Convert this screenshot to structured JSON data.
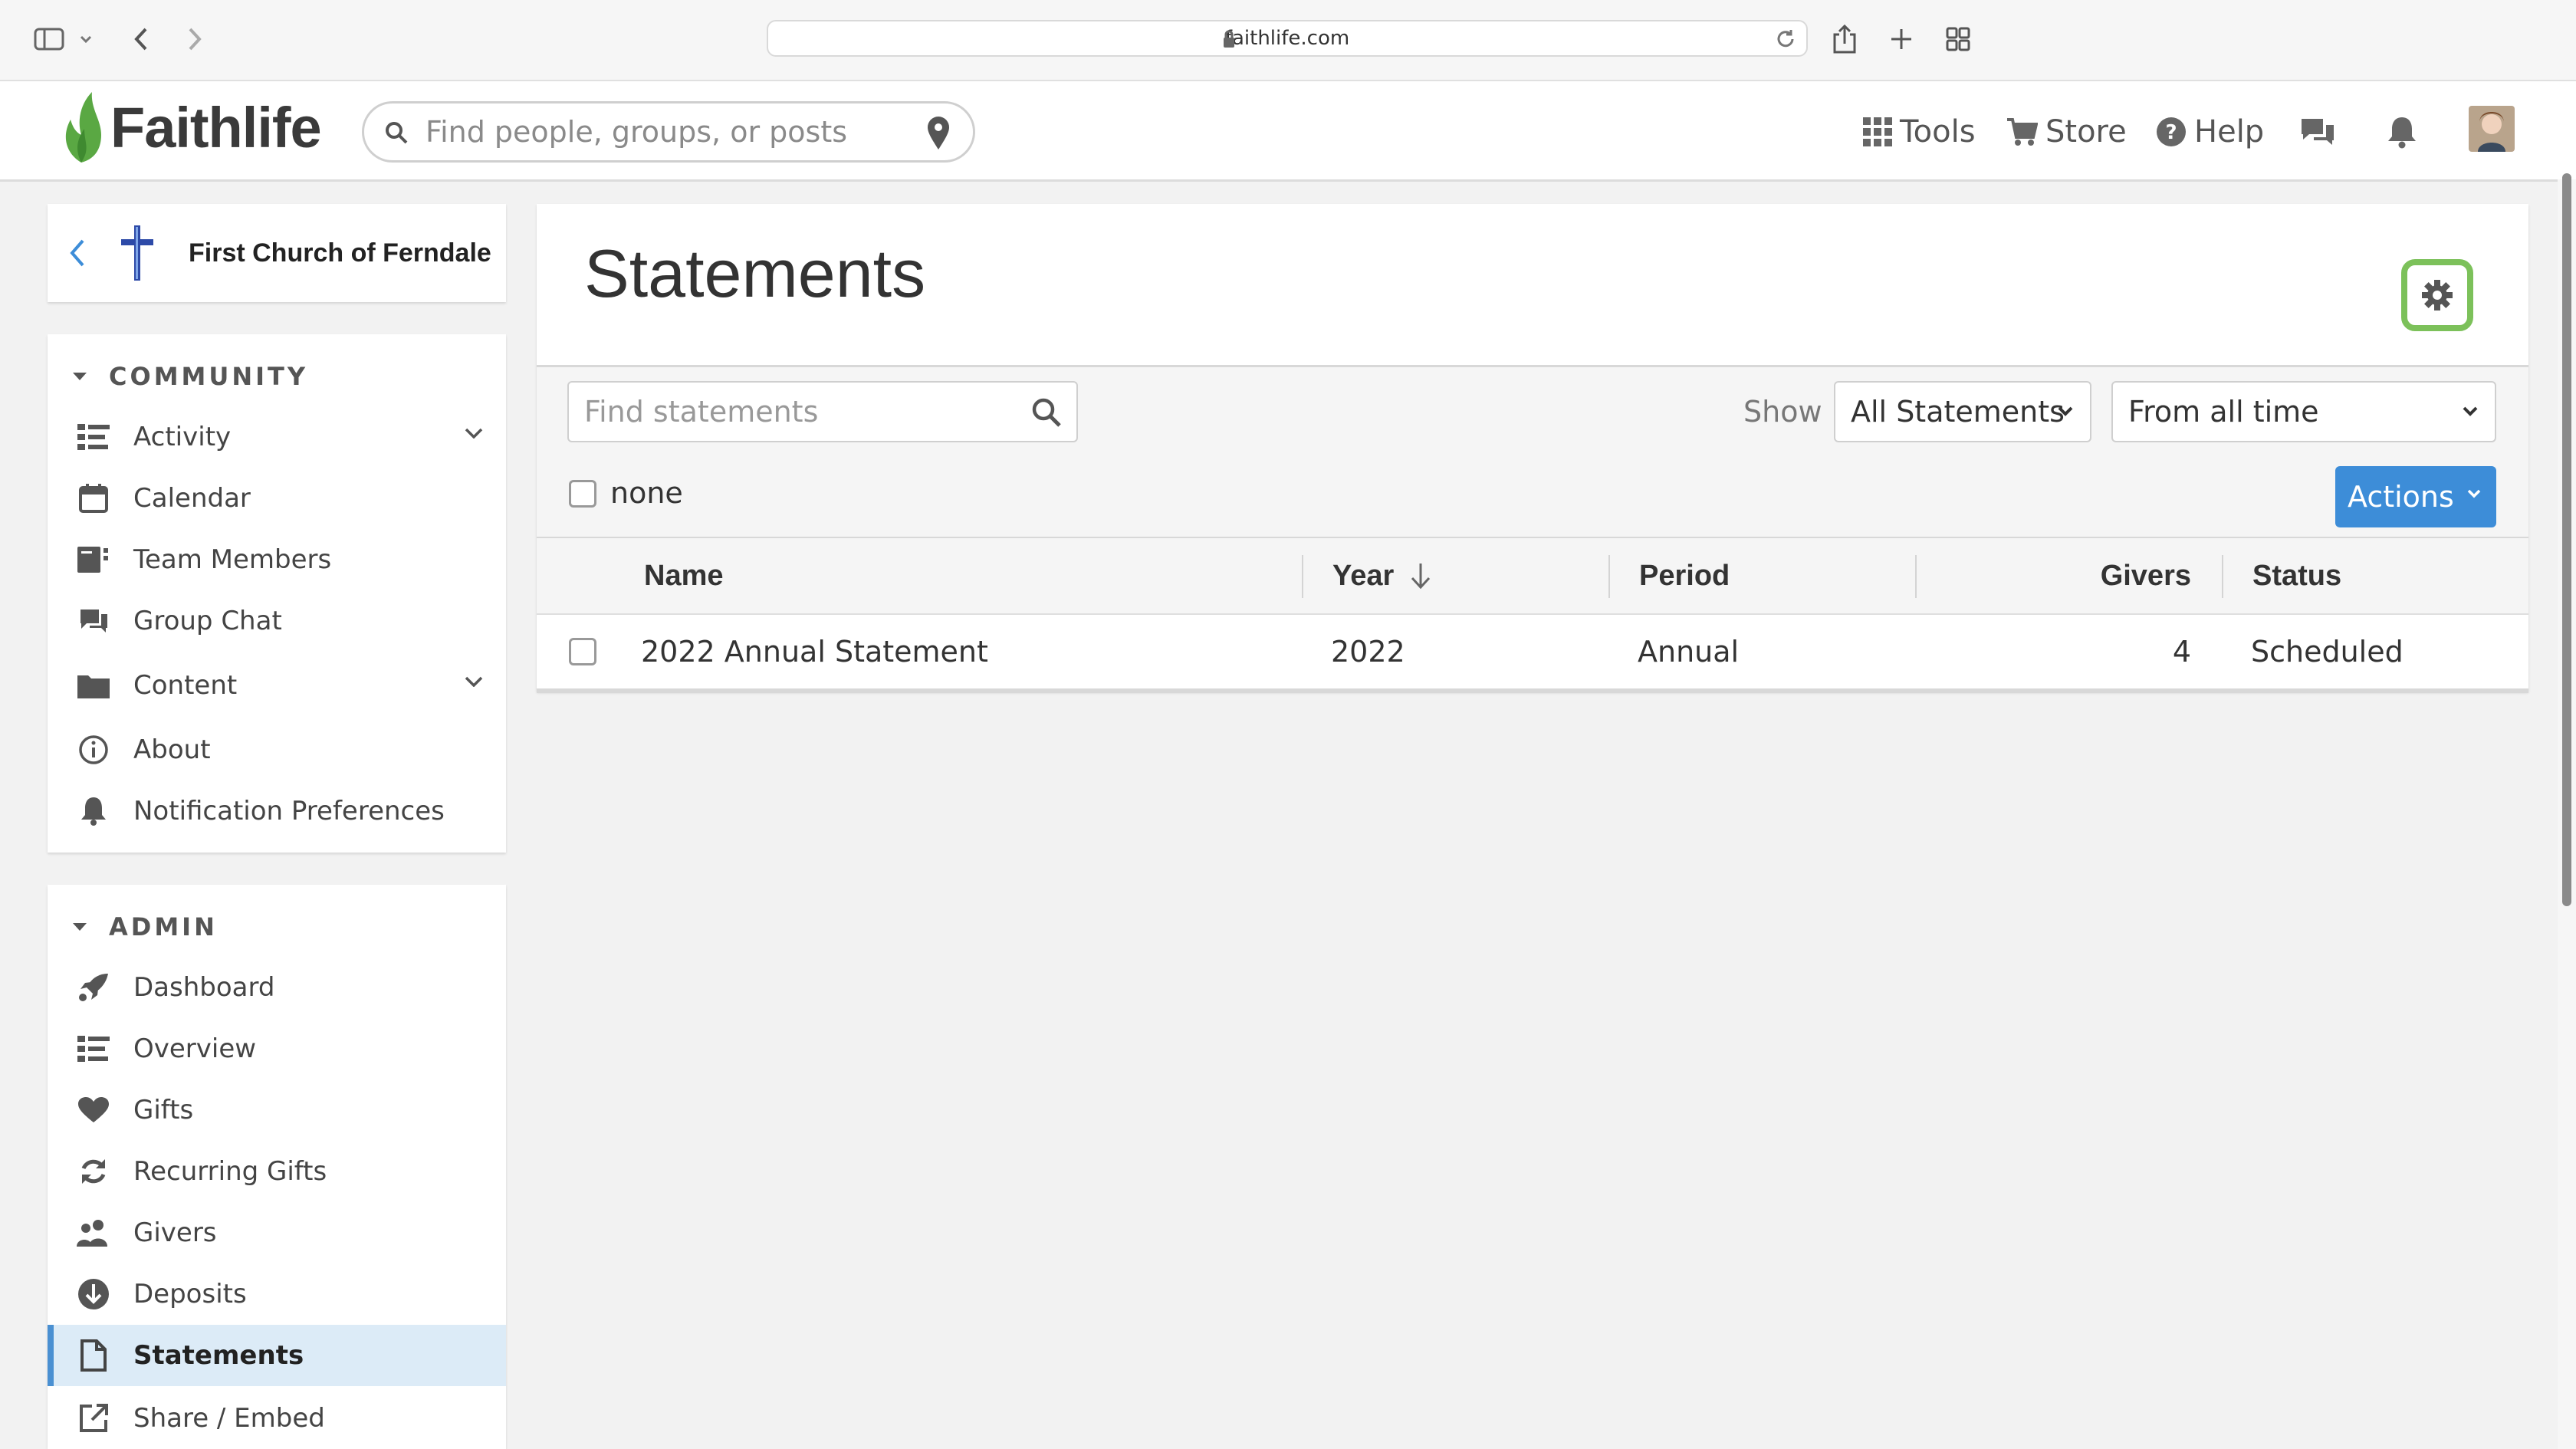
{
  "browser": {
    "url": "faithlife.com"
  },
  "header": {
    "logo_text": "Faithlife",
    "search_placeholder": "Find people, groups, or posts",
    "nav": [
      {
        "label": "Tools",
        "icon": "grid-icon"
      },
      {
        "label": "Store",
        "icon": "cart-icon"
      },
      {
        "label": "Help",
        "icon": "help-circle-icon"
      }
    ]
  },
  "sidebar": {
    "group_name": "First Church of Ferndale",
    "community": {
      "heading": "COMMUNITY",
      "items": [
        {
          "label": "Activity",
          "icon": "list-icon",
          "expandable": true
        },
        {
          "label": "Calendar",
          "icon": "calendar-icon"
        },
        {
          "label": "Team Members",
          "icon": "team-members-icon"
        },
        {
          "label": "Group Chat",
          "icon": "chat-icon"
        },
        {
          "label": "Content",
          "icon": "folder-icon",
          "expandable": true
        },
        {
          "label": "About",
          "icon": "info-icon"
        },
        {
          "label": "Notification Preferences",
          "icon": "bell-icon"
        }
      ]
    },
    "admin": {
      "heading": "ADMIN",
      "items": [
        {
          "label": "Dashboard",
          "icon": "rocket-icon"
        },
        {
          "label": "Overview",
          "icon": "list-icon"
        },
        {
          "label": "Gifts",
          "icon": "heart-icon"
        },
        {
          "label": "Recurring Gifts",
          "icon": "refresh-icon"
        },
        {
          "label": "Givers",
          "icon": "people-icon"
        },
        {
          "label": "Deposits",
          "icon": "arrow-down-circle-icon"
        },
        {
          "label": "Statements",
          "icon": "document-icon",
          "active": true
        },
        {
          "label": "Share / Embed",
          "icon": "external-link-icon"
        }
      ]
    }
  },
  "main": {
    "title": "Statements",
    "find_placeholder": "Find statements",
    "show_label": "Show",
    "filter_type": "All Statements",
    "filter_time": "From all time",
    "select_label": "none",
    "actions_label": "Actions",
    "columns": [
      "Name",
      "Year",
      "Period",
      "Givers",
      "Status"
    ],
    "rows": [
      {
        "name": "2022 Annual Statement",
        "year": "2022",
        "period": "Annual",
        "givers": "4",
        "status": "Scheduled"
      }
    ]
  },
  "colors": {
    "accent_blue": "#3d8dd8",
    "active_bg": "#dcebf7",
    "highlight_green": "#7cc15a",
    "logo_green": "#5aa843"
  }
}
